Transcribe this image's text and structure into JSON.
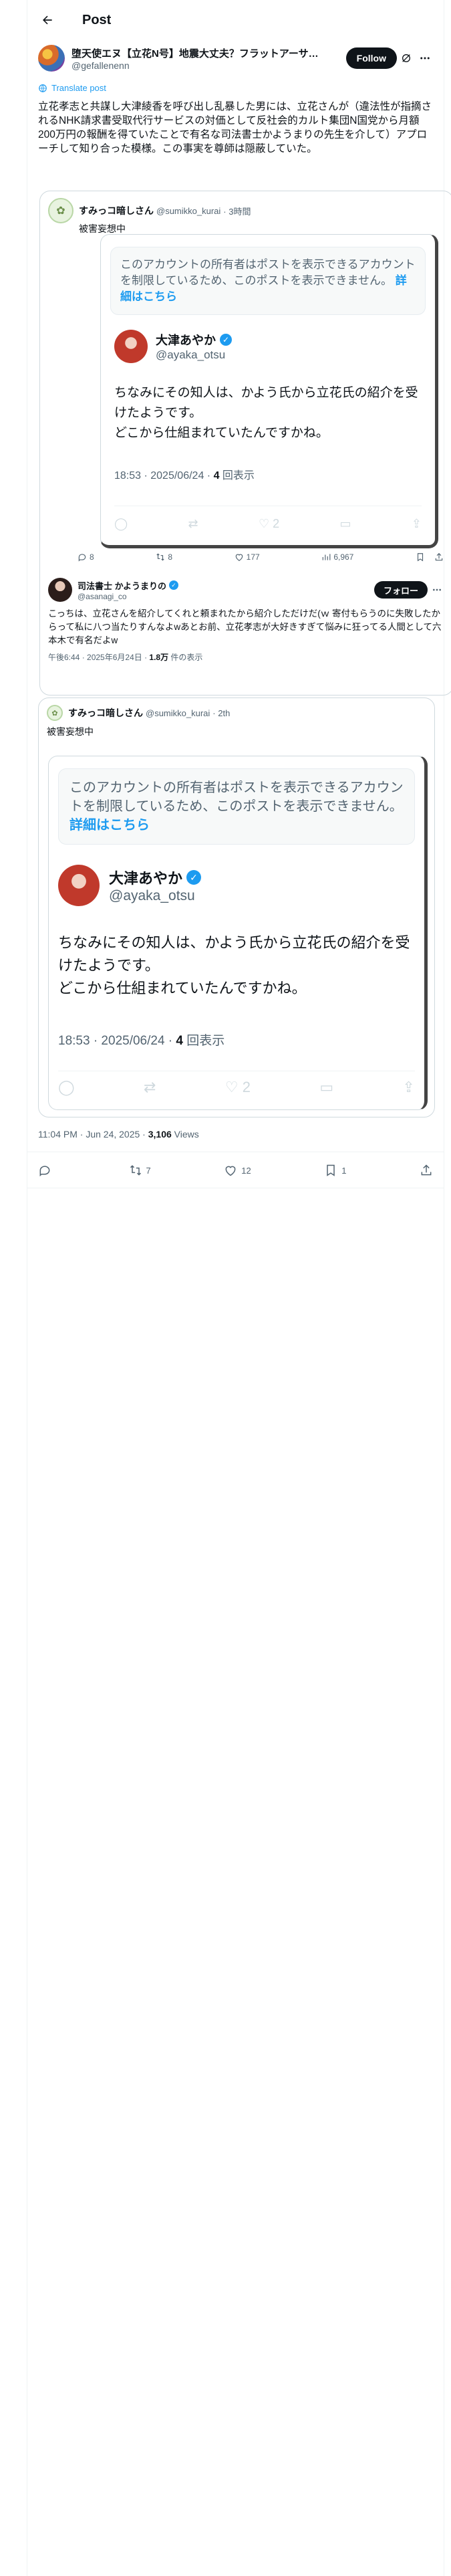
{
  "header": {
    "title": "Post"
  },
  "post": {
    "author_name": "堕天使エヌ【立花N号】地震大丈夫？フラットアーサ…",
    "author_handle": "@gefallenenn",
    "follow_label": "Follow",
    "translate_label": "Translate post",
    "text": "立花孝志と共謀し大津綾香を呼び出し乱暴した男には、立花さんが（違法性が指摘されるNHK請求書受取代行サービスの対価として反社会的カルト集団N国党から月額200万円の報酬を得ていたことで有名な司法書士かようまりの先生を介して）アプローチして知り合った模様。この事実を尊師は隠蔽していた。",
    "time": "11:04 PM · Jun 24, 2025 · ",
    "views": "3,106",
    "views_label": " Views",
    "replies": "",
    "reposts": "7",
    "likes": "12",
    "bookmarks": "1"
  },
  "embed1": {
    "name": "すみっコ暗しさん",
    "handle": "@sumikko_kurai",
    "time": "· 3時間",
    "text": "被害妄想中",
    "restricted": "このアカウントの所有者はポストを表示できるアカウントを制限しているため、このポストを表示できません。",
    "learn_more": "詳細はこちら",
    "quoted_name": "大津あやか",
    "quoted_handle": "@ayaka_otsu",
    "quoted_text": "ちなみにその知人は、かよう氏から立花氏の紹介を受けたようです。\nどこから仕組まれていたんですかね。",
    "quoted_time": "18:53 · 2025/06/24 · ",
    "quoted_views": "4",
    "quoted_views_label": " 回表示",
    "quoted_likes": "2",
    "replies": "8",
    "reposts": "8",
    "likes": "177",
    "views": "6,967"
  },
  "reply": {
    "name": "司法書士 かようまりの",
    "handle": "@asanagi_co",
    "follow_label": "フォロー",
    "text": "こっちは、立花さんを紹介してくれと頼まれたから紹介しただけだ(ｗ 寄付もらうのに失敗したからって私に八つ当たりすんなよwあとお前、立花孝志が大好きすぎて悩みに狂ってる人間として六本木で有名だよw",
    "time": "午後6:44 · 2025年6月24日 · ",
    "views": "1.8万",
    "views_label": " 件の表示"
  },
  "embed2": {
    "name": "すみっコ暗しさん",
    "handle": "@sumikko_kurai",
    "time": "· 2th",
    "text": "被害妄想中",
    "restricted": "このアカウントの所有者はポストを表示できるアカウントを制限しているため、このポストを表示できません。",
    "learn_more": "詳細はこちら",
    "quoted_name": "大津あやか",
    "quoted_handle": "@ayaka_otsu",
    "quoted_text": "ちなみにその知人は、かよう氏から立花氏の紹介を受けたようです。\nどこから仕組まれていたんですかね。",
    "quoted_time": "18:53 · 2025/06/24 · ",
    "quoted_views": "4",
    "quoted_views_label": " 回表示",
    "quoted_likes": "2"
  }
}
